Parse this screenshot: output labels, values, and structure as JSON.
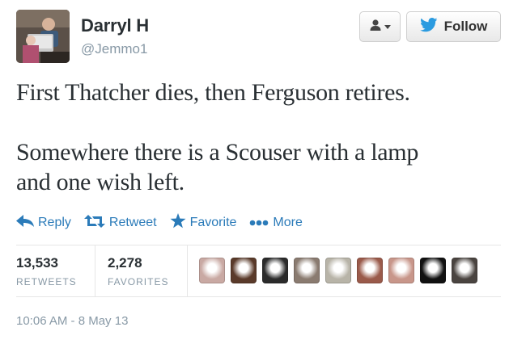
{
  "user": {
    "name": "Darryl H",
    "handle": "@Jemmo1"
  },
  "buttons": {
    "follow_label": "Follow"
  },
  "tweet": {
    "lines": [
      "First Thatcher dies, then Ferguson retires.",
      "Somewhere there is a Scouser with a lamp",
      "and one wish left."
    ]
  },
  "actions": {
    "reply": "Reply",
    "retweet": "Retweet",
    "favorite": "Favorite",
    "more": "More"
  },
  "stats": {
    "retweets_count": "13,533",
    "retweets_label": "RETWEETS",
    "favorites_count": "2,278",
    "favorites_label": "FAVORITES"
  },
  "favoriters": [
    {
      "icon": "favoriter-avatar",
      "color": "#c9a9a3"
    },
    {
      "icon": "favoriter-avatar",
      "color": "#5a3a2a"
    },
    {
      "icon": "favoriter-avatar",
      "color": "#2b2b2b"
    },
    {
      "icon": "favoriter-avatar",
      "color": "#8a7b70"
    },
    {
      "icon": "favoriter-avatar",
      "color": "#b8b4a8"
    },
    {
      "icon": "favoriter-avatar",
      "color": "#9a5a4a"
    },
    {
      "icon": "favoriter-avatar",
      "color": "#c8968a"
    },
    {
      "icon": "favoriter-avatar",
      "color": "#111111"
    },
    {
      "icon": "favoriter-avatar",
      "color": "#4a4440"
    }
  ],
  "timestamp": "10:06 AM - 8 May 13",
  "colors": {
    "accent": "#2b7bb9",
    "muted": "#8899a6",
    "text": "#292f33"
  }
}
